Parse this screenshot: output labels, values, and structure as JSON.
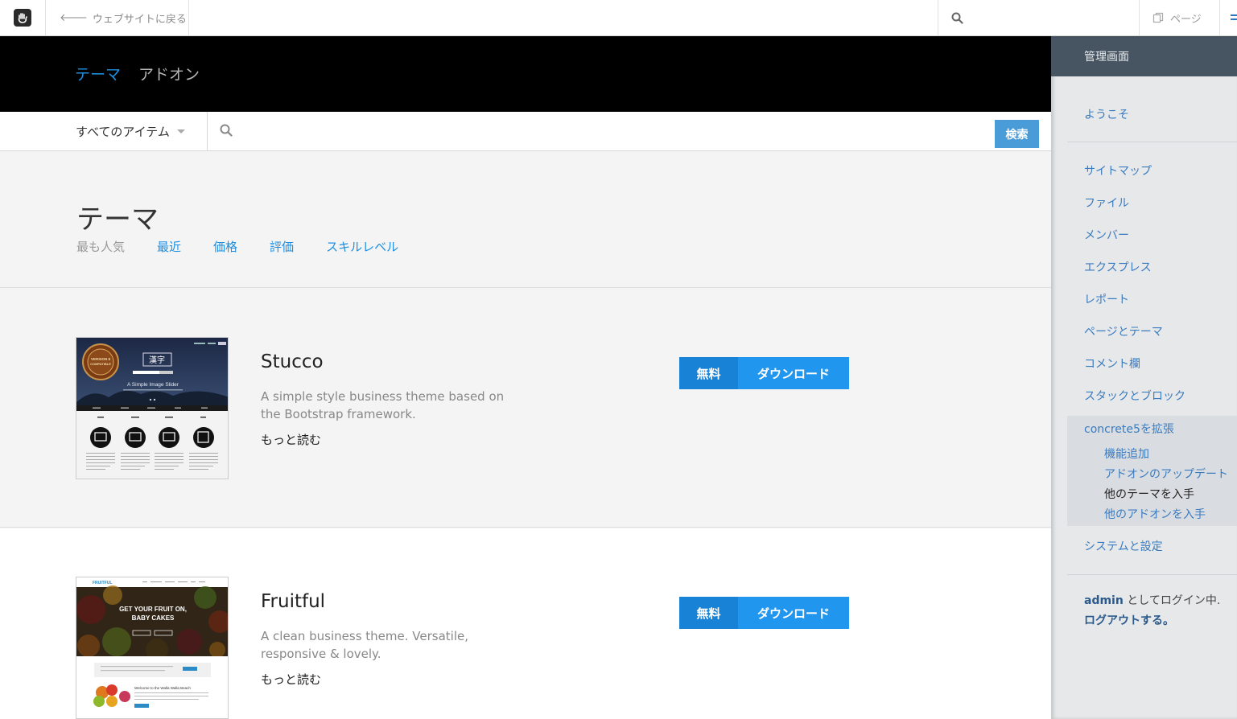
{
  "toolbar": {
    "back_label": "ウェブサイトに戻る",
    "page_label": "ページ"
  },
  "tabs": [
    {
      "label": "テーマ",
      "active": true
    },
    {
      "label": "アドオン",
      "active": false
    }
  ],
  "search": {
    "filter_selected": "すべてのアイテム",
    "placeholder": "",
    "button_label": "検索"
  },
  "section": {
    "title": "テーマ",
    "sorts": [
      {
        "label": "最も人気",
        "active": true
      },
      {
        "label": "最近",
        "active": false
      },
      {
        "label": "価格",
        "active": false
      },
      {
        "label": "評価",
        "active": false
      },
      {
        "label": "スキルレベル",
        "active": false
      }
    ]
  },
  "themes": [
    {
      "name": "Stucco",
      "description": "A simple style business theme based on the Bootstrap framework.",
      "more_label": "もっと読む",
      "price_label": "無料",
      "download_label": "ダウンロード",
      "thumb": {
        "slider_title": "A Simple Image Slider",
        "badge": "VERSION 8 COMPATIBLE",
        "features": [
          "Work",
          "Gallery",
          "About us",
          "Blog"
        ]
      }
    },
    {
      "name": "Fruitful",
      "description": "A clean business theme. Versatile, responsive & lovely.",
      "more_label": "もっと読む",
      "price_label": "無料",
      "download_label": "ダウンロード",
      "thumb": {
        "brand": "FRUITFUL",
        "hero_text": "GET YOUR FRUIT ON, BABY CAKES",
        "welcome_text": "Welcome to the Walla Walla Beach"
      }
    }
  ],
  "panel": {
    "header": "管理画面",
    "welcome": "ようこそ",
    "items": [
      "サイトマップ",
      "ファイル",
      "メンバー",
      "エクスプレス",
      "レポート",
      "ページとテーマ",
      "コメント欄",
      "スタックとブロック"
    ],
    "extend": {
      "label": "concrete5を拡張",
      "subitems": [
        {
          "label": "機能追加",
          "current": false
        },
        {
          "label": "アドオンのアップデート",
          "current": false
        },
        {
          "label": "他のテーマを入手",
          "current": true
        },
        {
          "label": "他のアドオンを入手",
          "current": false
        }
      ]
    },
    "system": "システムと設定",
    "login_user": "admin",
    "login_suffix": " としてログイン中.",
    "logout": "ログアウトする。"
  },
  "colors": {
    "accent": "#1e8fe0",
    "button_dark": "#1883d6",
    "button_light": "#2196ef",
    "panel_header": "#475461"
  }
}
